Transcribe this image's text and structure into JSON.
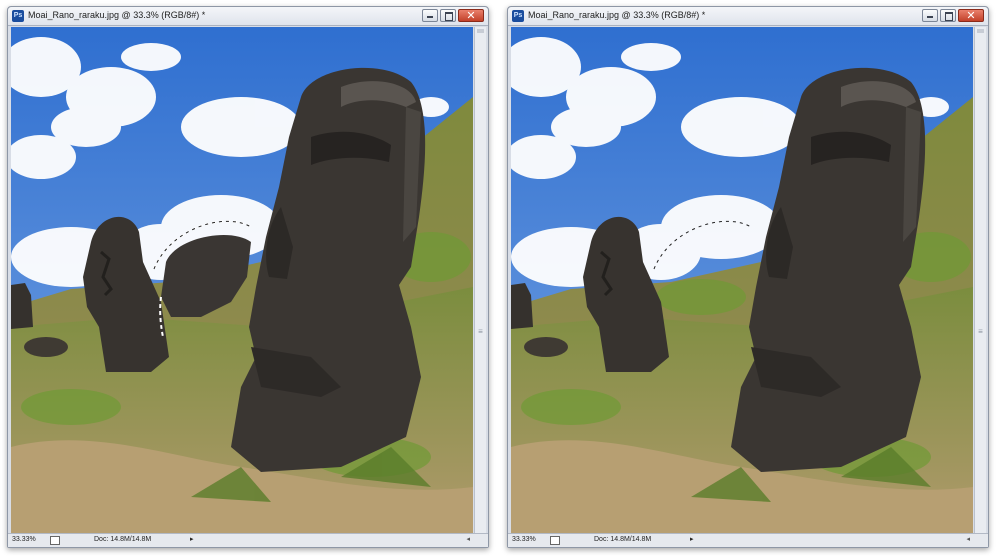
{
  "windows": [
    {
      "title": "Moai_Rano_raraku.jpg @ 33.3% (RGB/8#) *",
      "icon_label": "Ps",
      "zoom": "33.33%",
      "doc_size": "Doc: 14.8M/14.8M",
      "selection_visible": true
    },
    {
      "title": "Moai_Rano_raraku.jpg @ 33.3% (RGB/8#) *",
      "icon_label": "Ps",
      "zoom": "33.33%",
      "doc_size": "Doc: 14.8M/14.8M",
      "selection_visible": false
    }
  ],
  "controls": {
    "minimize": "minimize",
    "maximize": "maximize",
    "close_glyph": "✕",
    "status_arrow": "▸",
    "scroll_arrow": "◂"
  },
  "colors": {
    "sky": "#3f7fd6",
    "cloud": "#ffffff",
    "grass": "#6f8f3a",
    "dirt": "#a88d5c",
    "stone": "#3b3835",
    "close_button": "#c9472f"
  },
  "icons": [
    "photoshop-icon",
    "minimize-icon",
    "maximize-icon",
    "close-icon"
  ]
}
